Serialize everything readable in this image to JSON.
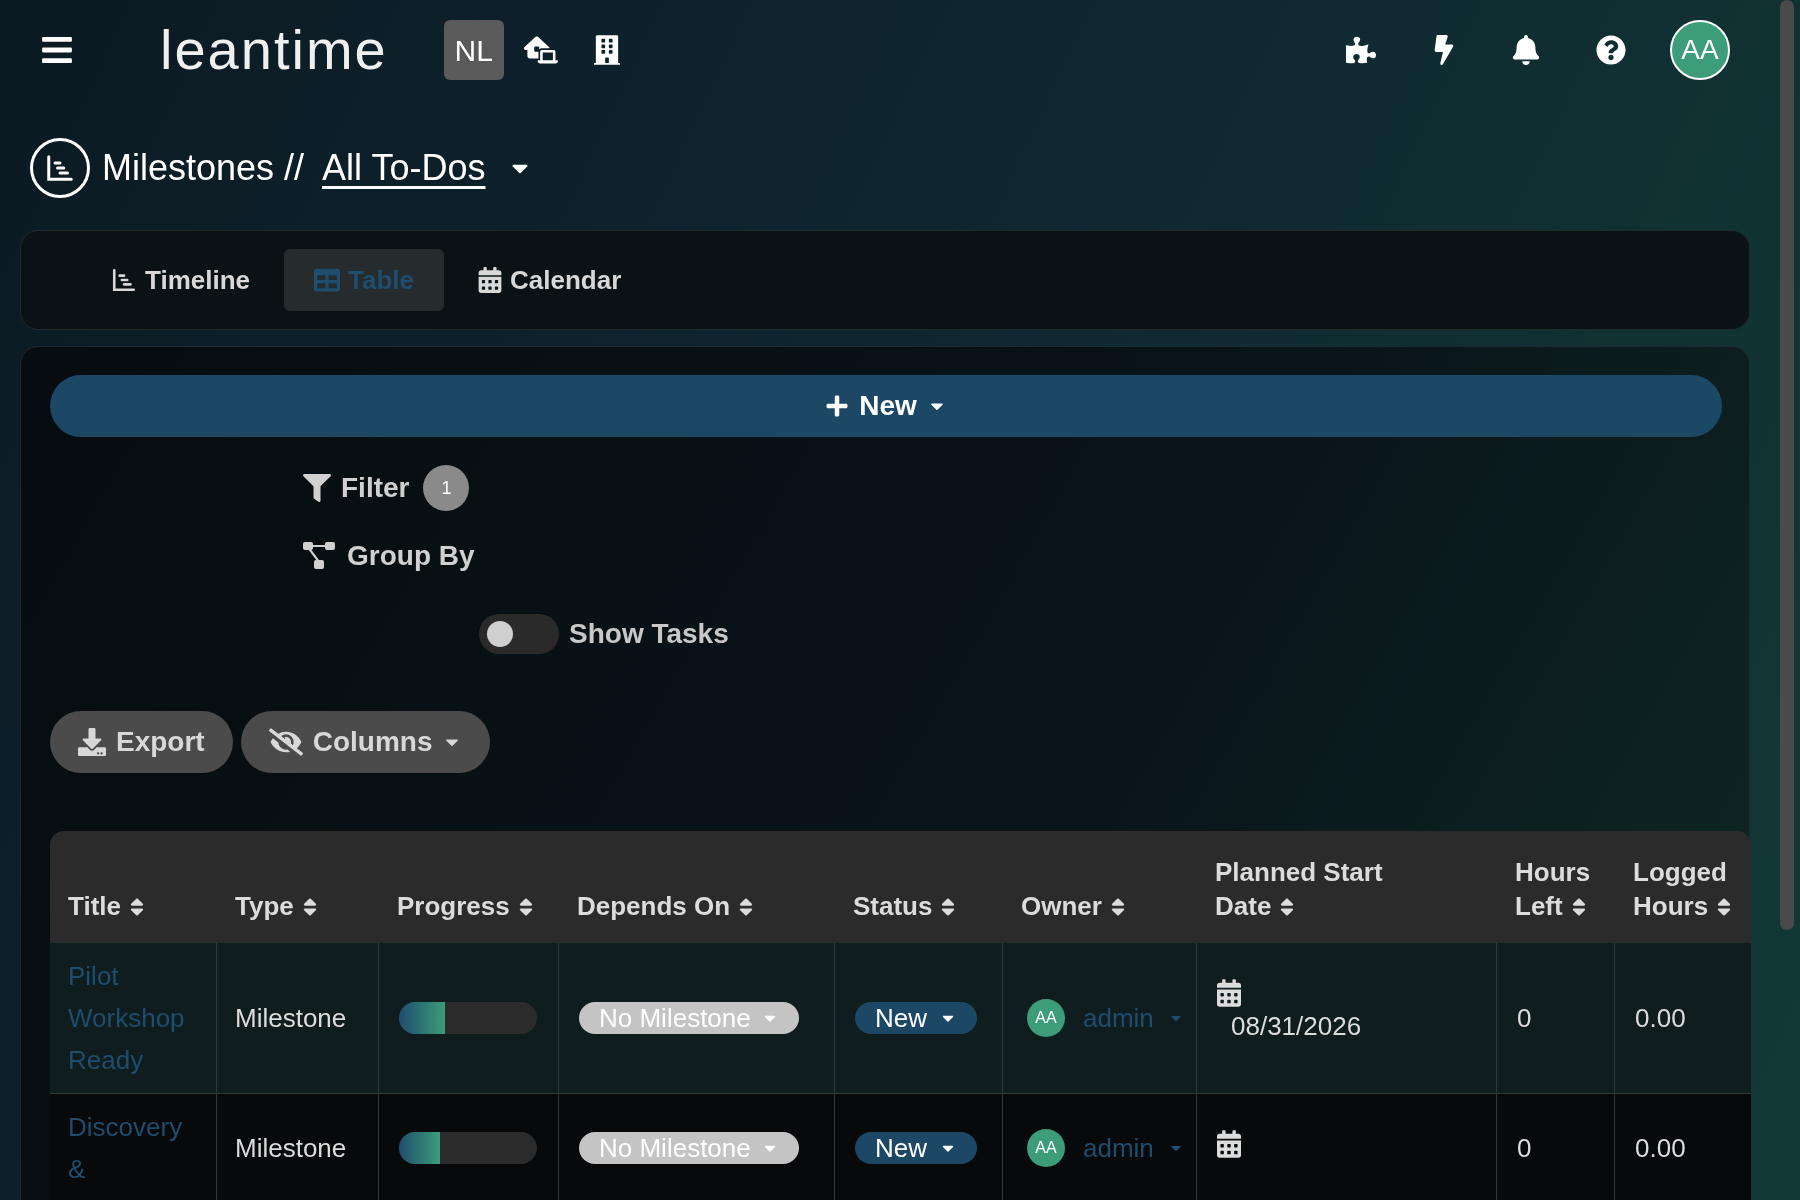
{
  "header": {
    "logo": "leantime",
    "workspace": "NL",
    "avatar": "AA"
  },
  "breadcrumb": {
    "section": "Milestones //",
    "view": "All To-Dos"
  },
  "tabs": [
    {
      "label": "Timeline",
      "kind": "timeline",
      "selected": false
    },
    {
      "label": "Table",
      "kind": "table",
      "selected": true
    },
    {
      "label": "Calendar",
      "kind": "calendar",
      "selected": false
    }
  ],
  "toolbar": {
    "new_button": "New",
    "filter": "Filter",
    "filter_count": "1",
    "group_by": "Group By",
    "show_tasks": {
      "label": "Show Tasks",
      "on": false
    },
    "export": "Export",
    "columns": "Columns"
  },
  "table": {
    "columns": [
      "Title",
      "Type",
      "Progress",
      "Depends On",
      "Status",
      "Owner",
      "Planned Start Date",
      "Hours Left",
      "Logged Hours"
    ],
    "rows": [
      {
        "title": "Pilot Workshop Ready",
        "type": "Milestone",
        "progress": {
          "level": 0.33
        },
        "depends_on": "No Milestone",
        "status": "New",
        "owner_initials": "AA",
        "owner": "admin",
        "planned_start": "08/31/2026",
        "hours_left": "0",
        "logged_hours": "0.00"
      },
      {
        "title": "Discovery &",
        "type": "Milestone",
        "progress": {
          "level": 0.3
        },
        "depends_on": "No Milestone",
        "status": "New",
        "owner_initials": "AA",
        "owner": "admin",
        "hours_left": "0",
        "logged_hours": "0.00"
      }
    ]
  }
}
